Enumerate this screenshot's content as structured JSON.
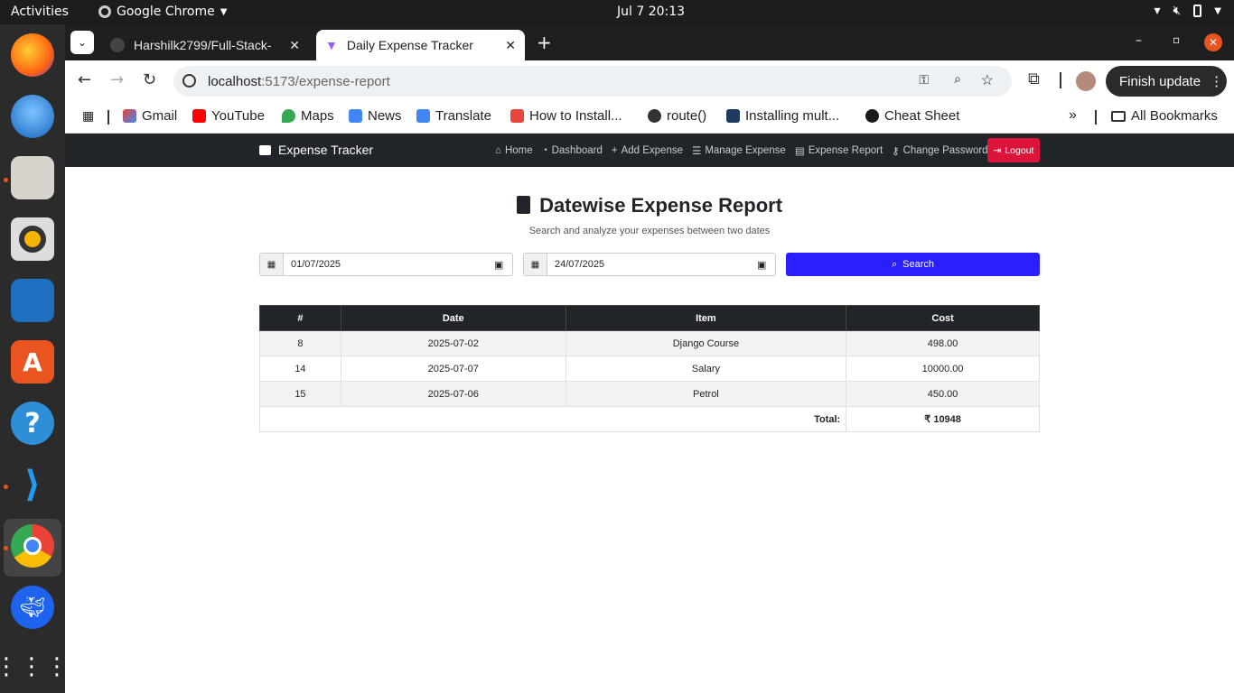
{
  "os": {
    "activities": "Activities",
    "app_name": "Google Chrome",
    "clock": "Jul 7  20:13"
  },
  "browser": {
    "tabs": [
      {
        "label": "Harshilk2799/Full-Stack-"
      },
      {
        "label": "Daily Expense Tracker"
      }
    ],
    "url_host": "localhost",
    "url_rest": ":5173/expense-report",
    "update_button": "Finish update",
    "bookmarks": [
      "Gmail",
      "YouTube",
      "Maps",
      "News",
      "Translate",
      "How to Install...",
      "route()",
      "Installing mult...",
      "Cheat Sheet"
    ],
    "all_bookmarks": "All Bookmarks"
  },
  "navbar": {
    "brand": "Expense Tracker",
    "links": [
      "Home",
      "Dashboard",
      "Add Expense",
      "Manage Expense",
      "Expense Report",
      "Change Password"
    ],
    "logout": "Logout"
  },
  "report": {
    "title": "Datewise Expense Report",
    "subtitle": "Search and analyze your expenses between two dates",
    "from_date": "01/07/2025",
    "to_date": "24/07/2025",
    "search_label": "Search",
    "columns": [
      "#",
      "Date",
      "Item",
      "Cost"
    ],
    "rows": [
      {
        "id": "8",
        "date": "2025-07-02",
        "item": "Django Course",
        "cost": "498.00"
      },
      {
        "id": "14",
        "date": "2025-07-07",
        "item": "Salary",
        "cost": "10000.00"
      },
      {
        "id": "15",
        "date": "2025-07-06",
        "item": "Petrol",
        "cost": "450.00"
      }
    ],
    "total_label": "Total:",
    "total_value": "₹ 10948"
  },
  "colors": {
    "navbar_bg": "#212529",
    "logout_bg": "#dc143c",
    "search_bg": "#2a1fff"
  }
}
